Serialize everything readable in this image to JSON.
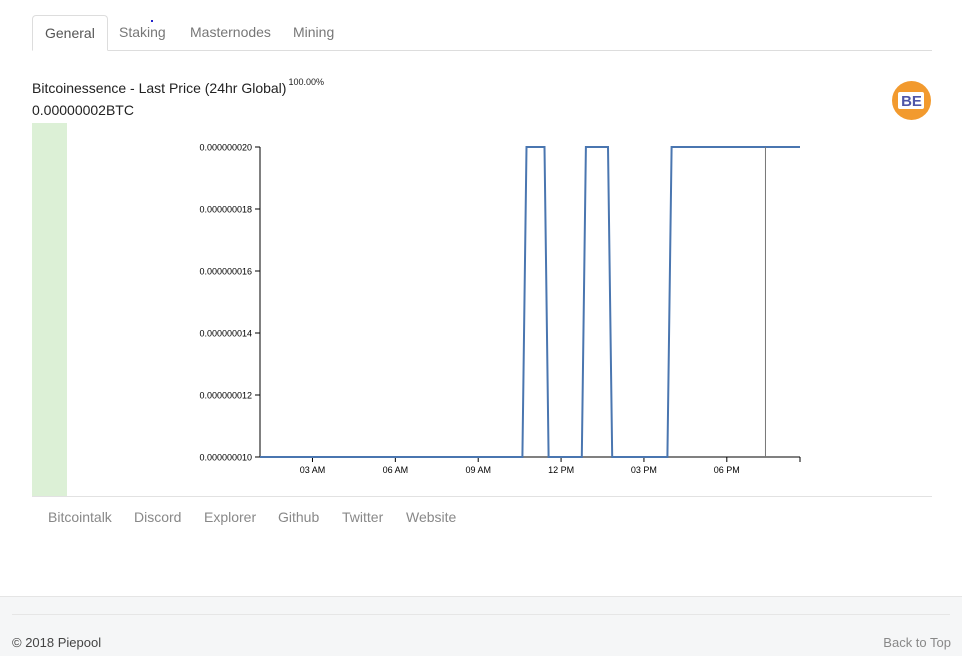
{
  "tabs": [
    {
      "label": "General",
      "active": true
    },
    {
      "label": "Staking",
      "active": false
    },
    {
      "label": "Masternodes",
      "active": false
    },
    {
      "label": "Mining",
      "active": false
    }
  ],
  "header": {
    "title": "Bitcoinessence - Last Price (24hr Global)",
    "change": "100.00%",
    "price": "0.00000002BTC",
    "logo_text": "BE",
    "logo_color": "#f29a2e"
  },
  "chart_data": {
    "type": "line",
    "y_ticks": [
      "0.000000020",
      "0.000000018",
      "0.000000016",
      "0.000000014",
      "0.000000012",
      "0.000000010"
    ],
    "ylim": [
      1e-08,
      2e-08
    ],
    "x_ticks": [
      "03 AM",
      "06 AM",
      "09 AM",
      "12 PM",
      "03 PM",
      "06 PM"
    ],
    "x_tick_hours": [
      3,
      6,
      9,
      12,
      15,
      18
    ],
    "xlim_hours": [
      1.1,
      20.65
    ],
    "series": [
      {
        "color": "#4a76b0",
        "x": [
          1.1,
          10.6,
          10.75,
          11.4,
          11.55,
          12.75,
          12.9,
          13.7,
          13.85,
          15.85,
          16.0,
          20.65
        ],
        "y": [
          1e-08,
          1e-08,
          2e-08,
          2e-08,
          1e-08,
          1e-08,
          2e-08,
          2e-08,
          1e-08,
          1e-08,
          2e-08,
          2e-08
        ]
      }
    ],
    "cursor_hour": 19.4
  },
  "footer_links": [
    "Bitcointalk",
    "Discord",
    "Explorer",
    "Github",
    "Twitter",
    "Website"
  ],
  "footer": {
    "copyright": "© 2018 Piepool",
    "back_to_top": "Back to Top"
  }
}
